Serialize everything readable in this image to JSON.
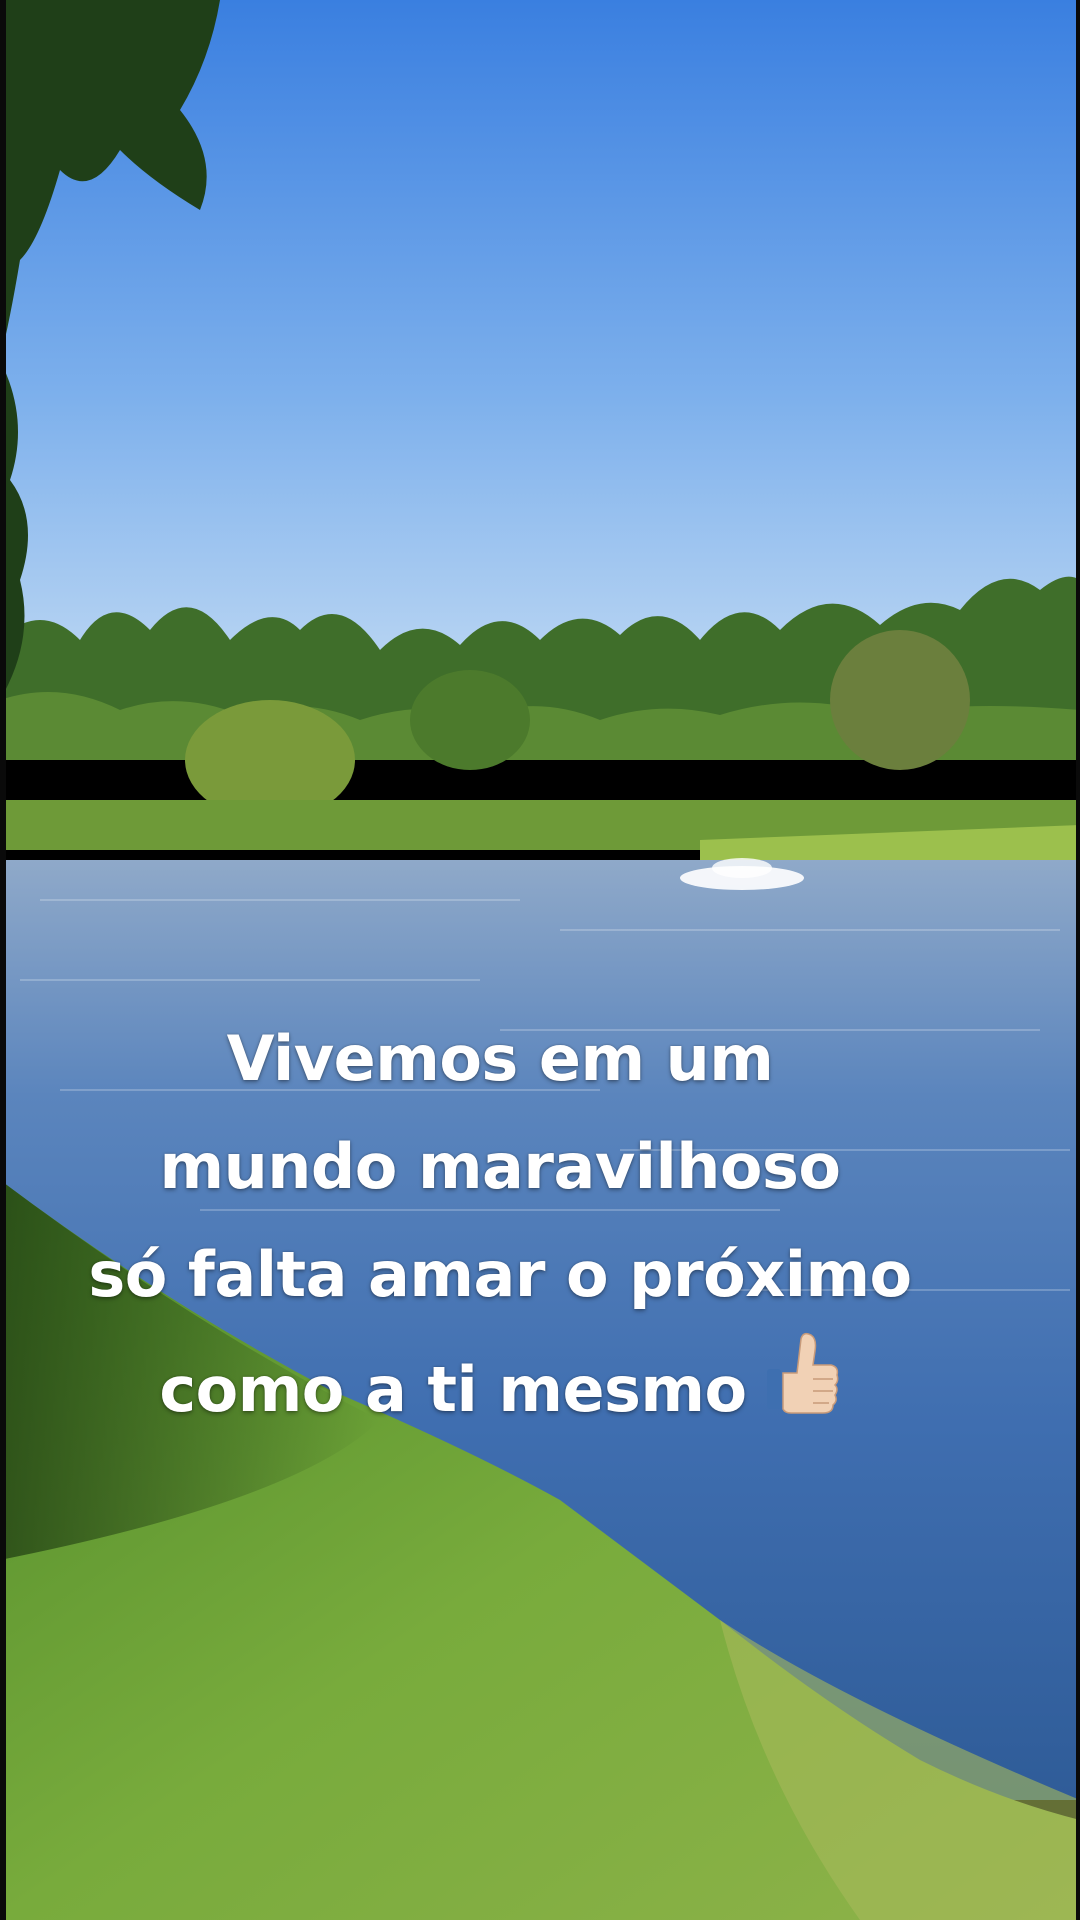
{
  "caption": {
    "line1": "Vivemos em um",
    "line2": "mundo maravilhoso",
    "line3": "só falta amar o próximo",
    "line4": "como a ti mesmo"
  },
  "icons": {
    "caption_emoji": "thumbs-up-icon"
  },
  "colors": {
    "sky_top": "#3f83e0",
    "sky_bottom": "#bcd9f4",
    "water": "#4a78b8",
    "grass": "#6fa63a",
    "text": "#ffffff"
  }
}
